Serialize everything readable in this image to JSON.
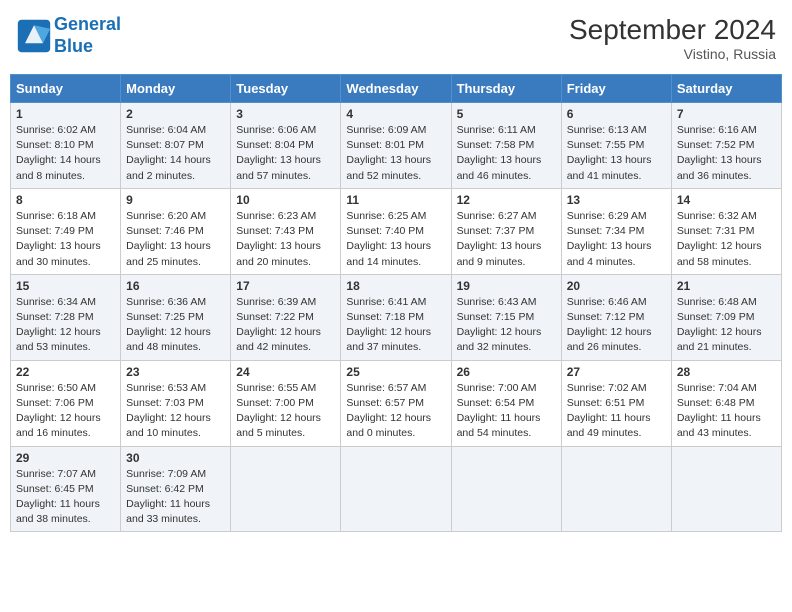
{
  "header": {
    "logo_line1": "General",
    "logo_line2": "Blue",
    "month": "September 2024",
    "location": "Vistino, Russia"
  },
  "days_of_week": [
    "Sunday",
    "Monday",
    "Tuesday",
    "Wednesday",
    "Thursday",
    "Friday",
    "Saturday"
  ],
  "weeks": [
    [
      {
        "day": 1,
        "sunrise": "6:02 AM",
        "sunset": "8:10 PM",
        "daylight": "14 hours and 8 minutes."
      },
      {
        "day": 2,
        "sunrise": "6:04 AM",
        "sunset": "8:07 PM",
        "daylight": "14 hours and 2 minutes."
      },
      {
        "day": 3,
        "sunrise": "6:06 AM",
        "sunset": "8:04 PM",
        "daylight": "13 hours and 57 minutes."
      },
      {
        "day": 4,
        "sunrise": "6:09 AM",
        "sunset": "8:01 PM",
        "daylight": "13 hours and 52 minutes."
      },
      {
        "day": 5,
        "sunrise": "6:11 AM",
        "sunset": "7:58 PM",
        "daylight": "13 hours and 46 minutes."
      },
      {
        "day": 6,
        "sunrise": "6:13 AM",
        "sunset": "7:55 PM",
        "daylight": "13 hours and 41 minutes."
      },
      {
        "day": 7,
        "sunrise": "6:16 AM",
        "sunset": "7:52 PM",
        "daylight": "13 hours and 36 minutes."
      }
    ],
    [
      {
        "day": 8,
        "sunrise": "6:18 AM",
        "sunset": "7:49 PM",
        "daylight": "13 hours and 30 minutes."
      },
      {
        "day": 9,
        "sunrise": "6:20 AM",
        "sunset": "7:46 PM",
        "daylight": "13 hours and 25 minutes."
      },
      {
        "day": 10,
        "sunrise": "6:23 AM",
        "sunset": "7:43 PM",
        "daylight": "13 hours and 20 minutes."
      },
      {
        "day": 11,
        "sunrise": "6:25 AM",
        "sunset": "7:40 PM",
        "daylight": "13 hours and 14 minutes."
      },
      {
        "day": 12,
        "sunrise": "6:27 AM",
        "sunset": "7:37 PM",
        "daylight": "13 hours and 9 minutes."
      },
      {
        "day": 13,
        "sunrise": "6:29 AM",
        "sunset": "7:34 PM",
        "daylight": "13 hours and 4 minutes."
      },
      {
        "day": 14,
        "sunrise": "6:32 AM",
        "sunset": "7:31 PM",
        "daylight": "12 hours and 58 minutes."
      }
    ],
    [
      {
        "day": 15,
        "sunrise": "6:34 AM",
        "sunset": "7:28 PM",
        "daylight": "12 hours and 53 minutes."
      },
      {
        "day": 16,
        "sunrise": "6:36 AM",
        "sunset": "7:25 PM",
        "daylight": "12 hours and 48 minutes."
      },
      {
        "day": 17,
        "sunrise": "6:39 AM",
        "sunset": "7:22 PM",
        "daylight": "12 hours and 42 minutes."
      },
      {
        "day": 18,
        "sunrise": "6:41 AM",
        "sunset": "7:18 PM",
        "daylight": "12 hours and 37 minutes."
      },
      {
        "day": 19,
        "sunrise": "6:43 AM",
        "sunset": "7:15 PM",
        "daylight": "12 hours and 32 minutes."
      },
      {
        "day": 20,
        "sunrise": "6:46 AM",
        "sunset": "7:12 PM",
        "daylight": "12 hours and 26 minutes."
      },
      {
        "day": 21,
        "sunrise": "6:48 AM",
        "sunset": "7:09 PM",
        "daylight": "12 hours and 21 minutes."
      }
    ],
    [
      {
        "day": 22,
        "sunrise": "6:50 AM",
        "sunset": "7:06 PM",
        "daylight": "12 hours and 16 minutes."
      },
      {
        "day": 23,
        "sunrise": "6:53 AM",
        "sunset": "7:03 PM",
        "daylight": "12 hours and 10 minutes."
      },
      {
        "day": 24,
        "sunrise": "6:55 AM",
        "sunset": "7:00 PM",
        "daylight": "12 hours and 5 minutes."
      },
      {
        "day": 25,
        "sunrise": "6:57 AM",
        "sunset": "6:57 PM",
        "daylight": "12 hours and 0 minutes."
      },
      {
        "day": 26,
        "sunrise": "7:00 AM",
        "sunset": "6:54 PM",
        "daylight": "11 hours and 54 minutes."
      },
      {
        "day": 27,
        "sunrise": "7:02 AM",
        "sunset": "6:51 PM",
        "daylight": "11 hours and 49 minutes."
      },
      {
        "day": 28,
        "sunrise": "7:04 AM",
        "sunset": "6:48 PM",
        "daylight": "11 hours and 43 minutes."
      }
    ],
    [
      {
        "day": 29,
        "sunrise": "7:07 AM",
        "sunset": "6:45 PM",
        "daylight": "11 hours and 38 minutes."
      },
      {
        "day": 30,
        "sunrise": "7:09 AM",
        "sunset": "6:42 PM",
        "daylight": "11 hours and 33 minutes."
      },
      null,
      null,
      null,
      null,
      null
    ]
  ]
}
